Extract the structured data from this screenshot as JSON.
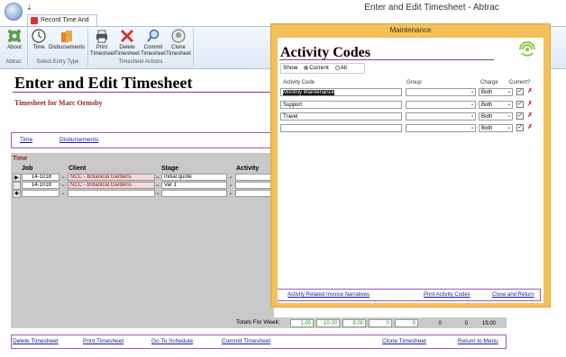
{
  "window": {
    "title": "Enter and Edit Timesheet - Abtrac"
  },
  "ribbon": {
    "tab_label": "Record Time And Cost",
    "buttons": [
      {
        "label": "About",
        "icon": "gear-icon"
      },
      {
        "label": "Time",
        "icon": "clock-icon"
      },
      {
        "label": "Disbursements",
        "icon": "bag-icon"
      },
      {
        "label": "Print Timesheet",
        "icon": "printer-icon"
      },
      {
        "label": "Delete Timesheet",
        "icon": "delete-icon"
      },
      {
        "label": "Commit Timesheet",
        "icon": "magnifier-icon"
      },
      {
        "label": "Clone Timesheet",
        "icon": "clone-icon"
      }
    ],
    "groups": [
      "Abtrac",
      "Select Entry Type",
      "Timesheet Actions"
    ]
  },
  "form": {
    "title": "Enter and Edit Timesheet",
    "subtitle": "Timesheet for Marc Ormsby",
    "entry_tabs": [
      "Time",
      "Disbursements"
    ],
    "section_label": "Time",
    "columns": [
      "Job",
      "Client",
      "Stage",
      "Activity"
    ],
    "rows": [
      {
        "job": "14-1018",
        "client": "NCC - Botanical Gardens",
        "stage": "Initial quote",
        "activity": ""
      },
      {
        "job": "14-1018",
        "client": "NCC - Botanical Gardens",
        "stage": "Var 1",
        "activity": ""
      }
    ],
    "totals_label": "Totals For Week:",
    "totals": [
      "1.00",
      "10.00",
      "8.00",
      "0",
      "0",
      "0",
      "0",
      "19.00"
    ],
    "bottom_links": [
      "Delete Timesheet",
      "Print Timesheet",
      "Go To Schedule",
      "Commit Timesheet",
      "Clone Timesheet",
      "Return to Menu"
    ]
  },
  "popup": {
    "window_title": "Maintenance",
    "title": "Activity Codes",
    "show_label": "Show",
    "show_options": [
      "Current",
      "All"
    ],
    "show_selected": "Current",
    "columns": [
      "Activity Code",
      "Group",
      "Charge",
      "Current?"
    ],
    "rows": [
      {
        "code": "Monthly Maintenance",
        "group": "",
        "charge": "Both",
        "current": true
      },
      {
        "code": "Support",
        "group": "",
        "charge": "Both",
        "current": true
      },
      {
        "code": "Travel",
        "group": "",
        "charge": "Both",
        "current": true
      },
      {
        "code": "",
        "group": "",
        "charge": "Both",
        "current": true
      }
    ],
    "links": [
      "Activity Related Invoice Narratives",
      "Print Activity Codes",
      "Close and Return"
    ]
  },
  "colors": {
    "accent_purple": "#9b59b6",
    "popup_frame": "#f3c15a",
    "link": "#1a1a9c",
    "red_label": "#9b1c1c"
  }
}
